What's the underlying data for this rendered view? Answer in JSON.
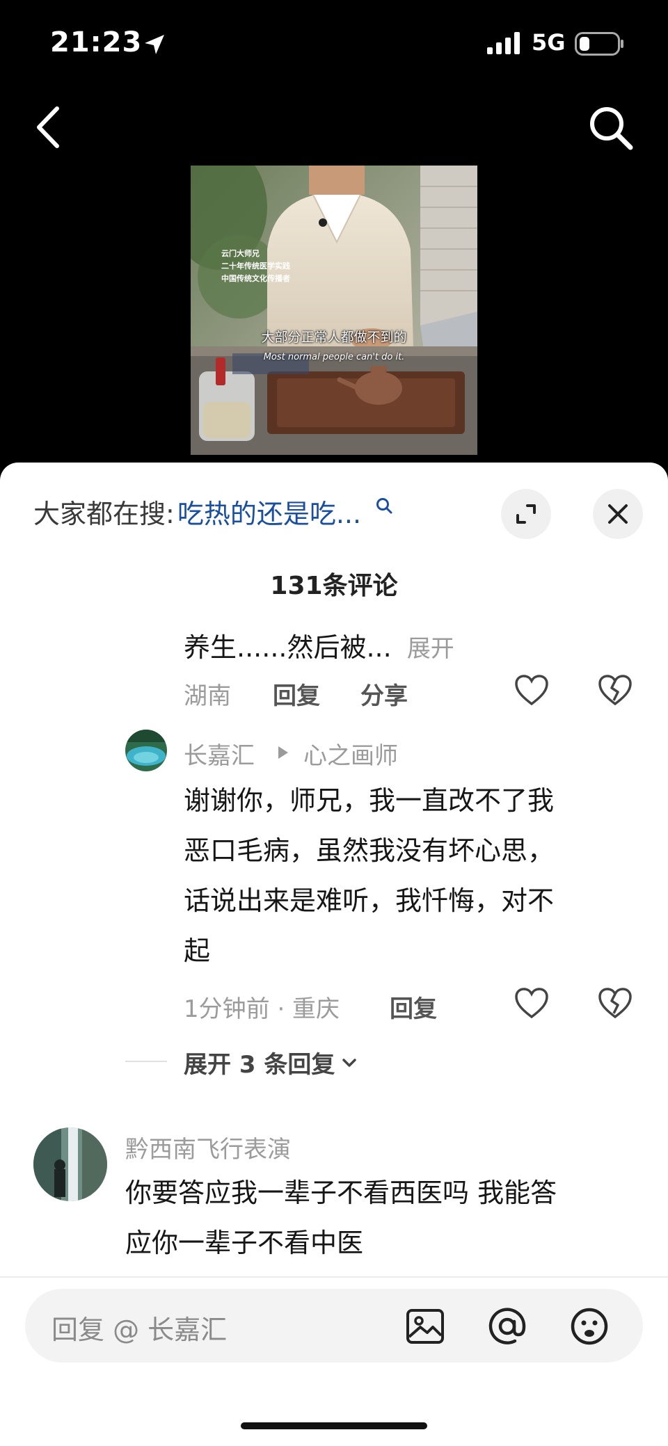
{
  "status_bar": {
    "time": "21:23",
    "network": "5G"
  },
  "video": {
    "side_text": [
      "云门大师兄",
      "二十年传统医学实践",
      "中国传统文化传播者"
    ],
    "caption_cn": "大部分正常人都做不到的",
    "caption_en": "Most normal people can't do it."
  },
  "sheet": {
    "search_prefix": "大家都在搜:",
    "search_query": "吃热的还是吃...",
    "comment_count": "131条评论"
  },
  "comments": {
    "c1": {
      "text": "养生......然后被...",
      "expand_label": "展开",
      "location": "湖南",
      "reply_label": "回复",
      "share_label": "分享"
    },
    "c2": {
      "author": "长嘉汇",
      "reply_to": "心之画师",
      "line1": "谢谢你，师兄，我一直改不了我",
      "line2": "恶口毛病，虽然我没有坏心思，",
      "line3": "话说出来是难听，我忏悔，对不",
      "line4": "起",
      "meta": "1分钟前 · 重庆",
      "reply_label": "回复",
      "expand_replies": "展开 3 条回复"
    },
    "c3": {
      "author": "黔西南飞行表演",
      "line1": "你要答应我一辈子不看西医吗 我能答",
      "line2": "应你一辈子不看中医"
    }
  },
  "input": {
    "placeholder": "回复 @ 长嘉汇"
  },
  "colors": {
    "link": "#1a4fa0",
    "muted": "#9b9b9b",
    "text": "#161616"
  }
}
